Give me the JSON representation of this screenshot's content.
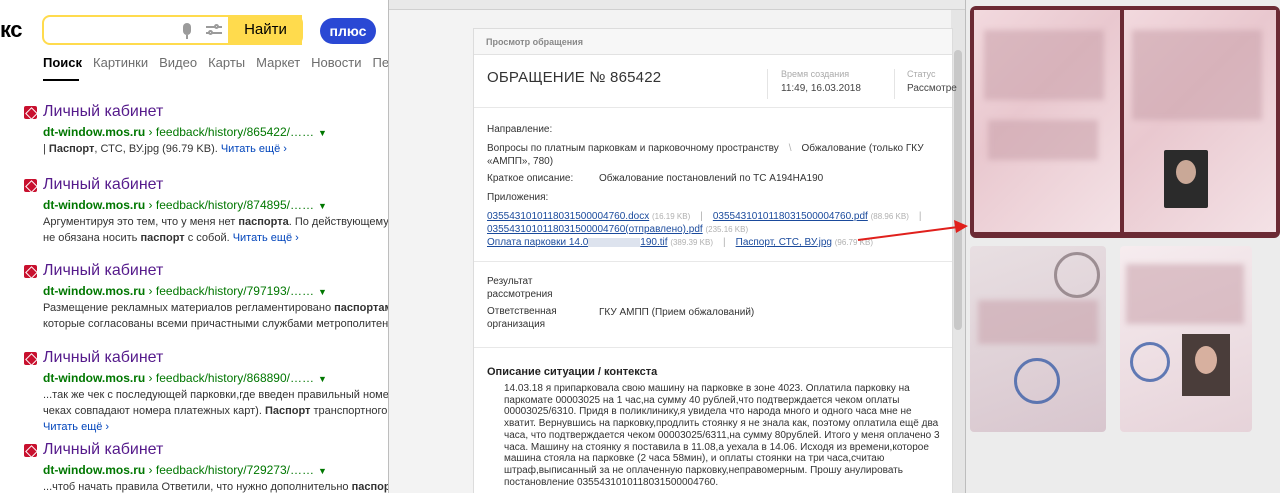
{
  "serp": {
    "logo": "кс",
    "search_button": "Найти",
    "plus_button": "плюс",
    "tabs": [
      "Поиск",
      "Картинки",
      "Видео",
      "Карты",
      "Маркет",
      "Новости",
      "Пере"
    ],
    "results": [
      {
        "title": "Личный кабинет",
        "domain": "dt-window.mos.ru",
        "path": " › feedback/history/865422/……",
        "snippet_lines": [
          {
            "parts": [
              {
                "t": "| "
              },
              {
                "t": "Паспорт",
                "b": true
              },
              {
                "t": ", СТС, ВУ.jpg (96.79 KB). "
              },
              {
                "t": "Читать ещё ›",
                "more": true
              }
            ]
          }
        ]
      },
      {
        "title": "Личный кабинет",
        "domain": "dt-window.mos.ru",
        "path": " › feedback/history/874895/……",
        "snippet_lines": [
          {
            "parts": [
              {
                "t": "Аргументируя это тем, что у меня нет "
              },
              {
                "t": "паспорта",
                "b": true
              },
              {
                "t": ". По действующему"
              }
            ]
          },
          {
            "parts": [
              {
                "t": "не обязана носить "
              },
              {
                "t": "паспорт",
                "b": true
              },
              {
                "t": " с собой. "
              },
              {
                "t": "Читать ещё ›",
                "more": true
              }
            ]
          }
        ]
      },
      {
        "title": "Личный кабинет",
        "domain": "dt-window.mos.ru",
        "path": " › feedback/history/797193/……",
        "snippet_lines": [
          {
            "parts": [
              {
                "t": "Размещение рекламных материалов регламентировано "
              },
              {
                "t": "паспортам",
                "b": true
              }
            ]
          },
          {
            "parts": [
              {
                "t": "которые согласованы всеми причастными службами метрополитена"
              }
            ]
          }
        ]
      },
      {
        "title": "Личный кабинет",
        "domain": "dt-window.mos.ru",
        "path": " › feedback/history/868890/……",
        "snippet_lines": [
          {
            "parts": [
              {
                "t": "...так же чек с последующей парковки,где введен правильный номер"
              }
            ]
          },
          {
            "parts": [
              {
                "t": "чеках совпадают номера платежных карт). "
              },
              {
                "t": "Паспорт",
                "b": true
              },
              {
                "t": " транспортного"
              }
            ]
          },
          {
            "parts": [
              {
                "t": "Читать ещё ›",
                "more": true
              }
            ]
          }
        ]
      },
      {
        "title": "Личный кабинет",
        "domain": "dt-window.mos.ru",
        "path": " › feedback/history/729273/……",
        "snippet_lines": [
          {
            "parts": [
              {
                "t": "...чтоб начать правила Ответили, что нужно дополнительно "
              },
              {
                "t": "паспорт",
                "b": true
              }
            ]
          }
        ]
      }
    ]
  },
  "appeal": {
    "breadcrumb": "Просмотр обращения",
    "title": "ОБРАЩЕНИЕ № 865422",
    "created_label": "Время создания",
    "created_value": "11:49, 16.03.2018",
    "status_label": "Статус",
    "status_value": "Рассмотре",
    "direction_label": "Направление:",
    "direction_value_1": "Вопросы по платным парковкам и парковочному пространству",
    "direction_value_2": "«АМПП», 780)",
    "direction_value_3": "Обжалование (только ГКУ",
    "summary_label": "Краткое описание:",
    "summary_value": "Обжалование постановлений по ТС А194НА190",
    "attachments_label": "Приложения:",
    "attachments": [
      {
        "name": "0355431010118031500004760.docx",
        "size": "(16.19 KB)"
      },
      {
        "name": "0355431010118031500004760.pdf",
        "size": "(88.96 KB)"
      },
      {
        "name": "0355431010118031500004760(отправлено).pdf",
        "size": "(235.16 KB)"
      },
      {
        "name_start": "Оплата парковки 14.0",
        "name_end": "190.tif",
        "size": "(389.39 KB)"
      },
      {
        "name": "Паспорт, СТС, ВУ.jpg",
        "size": "(96.79 KB)"
      }
    ],
    "result_label_1": "Результат",
    "result_label_2": "рассмотрения",
    "org_label_1": "Ответственная",
    "org_label_2": "организация",
    "org_value": "ГКУ АМПП (Прием обжалований)",
    "section_title": "Описание ситуации / контекста",
    "description_lines": [
      "14.03.18 я припарковала свою машину на парковке в зоне 4023. Оплатила парковку на",
      "паркомате 00003025 на 1 час,на сумму 40 рублей,что подтверждается чеком оплаты",
      "00003025/6310. Придя в поликлинику,я увидела что народа много и одного часа мне не",
      "хватит. Вернувшись на парковку,продлить стоянку я не знала как, поэтому оплатила ещё два",
      "часа, что подтверждается чеком 00003025/6311,на сумму 80рублей. Итого у меня оплачено 3",
      "часа. Машину на стоянку я поставила в 11.08,а уехала в 14.06. Исходя из времени,которое",
      "машина стояла на парковке (2 часа 58мин), и оплаты стоянки на три часа,считаю",
      "штраф,выписанный за не оплаченную парковку,неправомерным. Прошу анулировать",
      "постановление 0355431010118031500004760."
    ]
  },
  "colors": {
    "search_yellow": "#ffdb4d",
    "plus_blue": "#2a48d4",
    "result_title": "#551a8b",
    "result_url": "#007700",
    "arrow_red": "#e0201c"
  }
}
